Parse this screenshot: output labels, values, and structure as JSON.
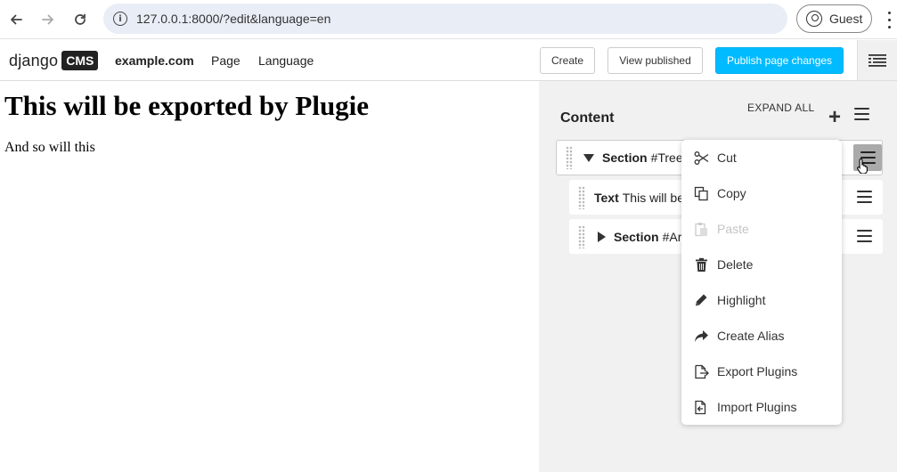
{
  "browser": {
    "url": "127.0.0.1:8000/?edit&language=en",
    "profile_label": "Guest"
  },
  "toolbar": {
    "logo_text": "django",
    "logo_badge": "CMS",
    "site_name": "example.com",
    "menu_page": "Page",
    "menu_language": "Language",
    "create_label": "Create",
    "view_published_label": "View published",
    "publish_label": "Publish page changes",
    "accent_color": "#00bbff"
  },
  "page": {
    "heading": "This will be exported by Plugie",
    "paragraph": "And so will this"
  },
  "structure": {
    "title": "Content",
    "expand_all": "EXPAND ALL",
    "plugins": [
      {
        "name": "Section",
        "desc": "#Tree",
        "expanded": true
      },
      {
        "name": "Text",
        "desc": "This will be"
      },
      {
        "name": "Section",
        "desc": "#Ar",
        "expanded": false
      }
    ]
  },
  "context_menu": {
    "items": [
      {
        "label": "Cut",
        "icon": "scissors-icon",
        "enabled": true
      },
      {
        "label": "Copy",
        "icon": "copy-icon",
        "enabled": true
      },
      {
        "label": "Paste",
        "icon": "paste-icon",
        "enabled": false
      },
      {
        "label": "Delete",
        "icon": "trash-icon",
        "enabled": true
      },
      {
        "label": "Highlight",
        "icon": "pen-icon",
        "enabled": true
      },
      {
        "label": "Create Alias",
        "icon": "share-arrow-icon",
        "enabled": true
      },
      {
        "label": "Export Plugins",
        "icon": "export-file-icon",
        "enabled": true
      },
      {
        "label": "Import Plugins",
        "icon": "import-file-icon",
        "enabled": true
      }
    ]
  }
}
